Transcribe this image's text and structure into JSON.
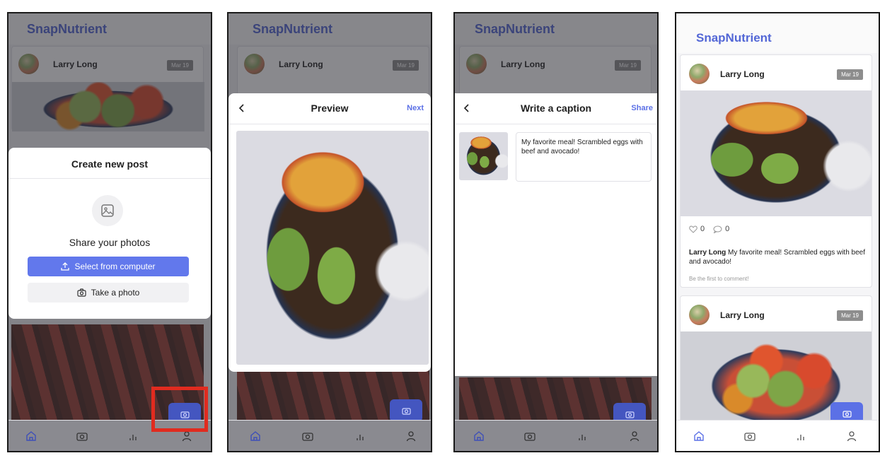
{
  "app": {
    "brand": "SnapNutrient"
  },
  "post": {
    "user": "Larry Long",
    "date": "Mar 19"
  },
  "create_modal": {
    "title": "Create new post",
    "subtitle": "Share your photos",
    "select_label": "Select from computer",
    "photo_label": "Take a photo"
  },
  "preview_modal": {
    "title": "Preview",
    "next_label": "Next"
  },
  "caption_modal": {
    "title": "Write a caption",
    "share_label": "Share",
    "caption_text": "My favorite meal! Scrambled eggs with beef and avocado!"
  },
  "feed_post": {
    "likes": "0",
    "comments": "0",
    "caption_user": "Larry Long",
    "caption_text": "My favorite meal! Scrambled eggs with beef and avocado!",
    "comment_prompt": "Be the first to comment!"
  },
  "colors": {
    "brand": "#5367d6",
    "primary": "#6278ec",
    "badge": "#8d8d8d",
    "highlight": "#e12b1f"
  },
  "icons": [
    "home-icon",
    "camera-icon",
    "chart-icon",
    "user-icon",
    "back-icon",
    "image-icon",
    "upload-icon",
    "heart-icon",
    "comment-icon"
  ]
}
